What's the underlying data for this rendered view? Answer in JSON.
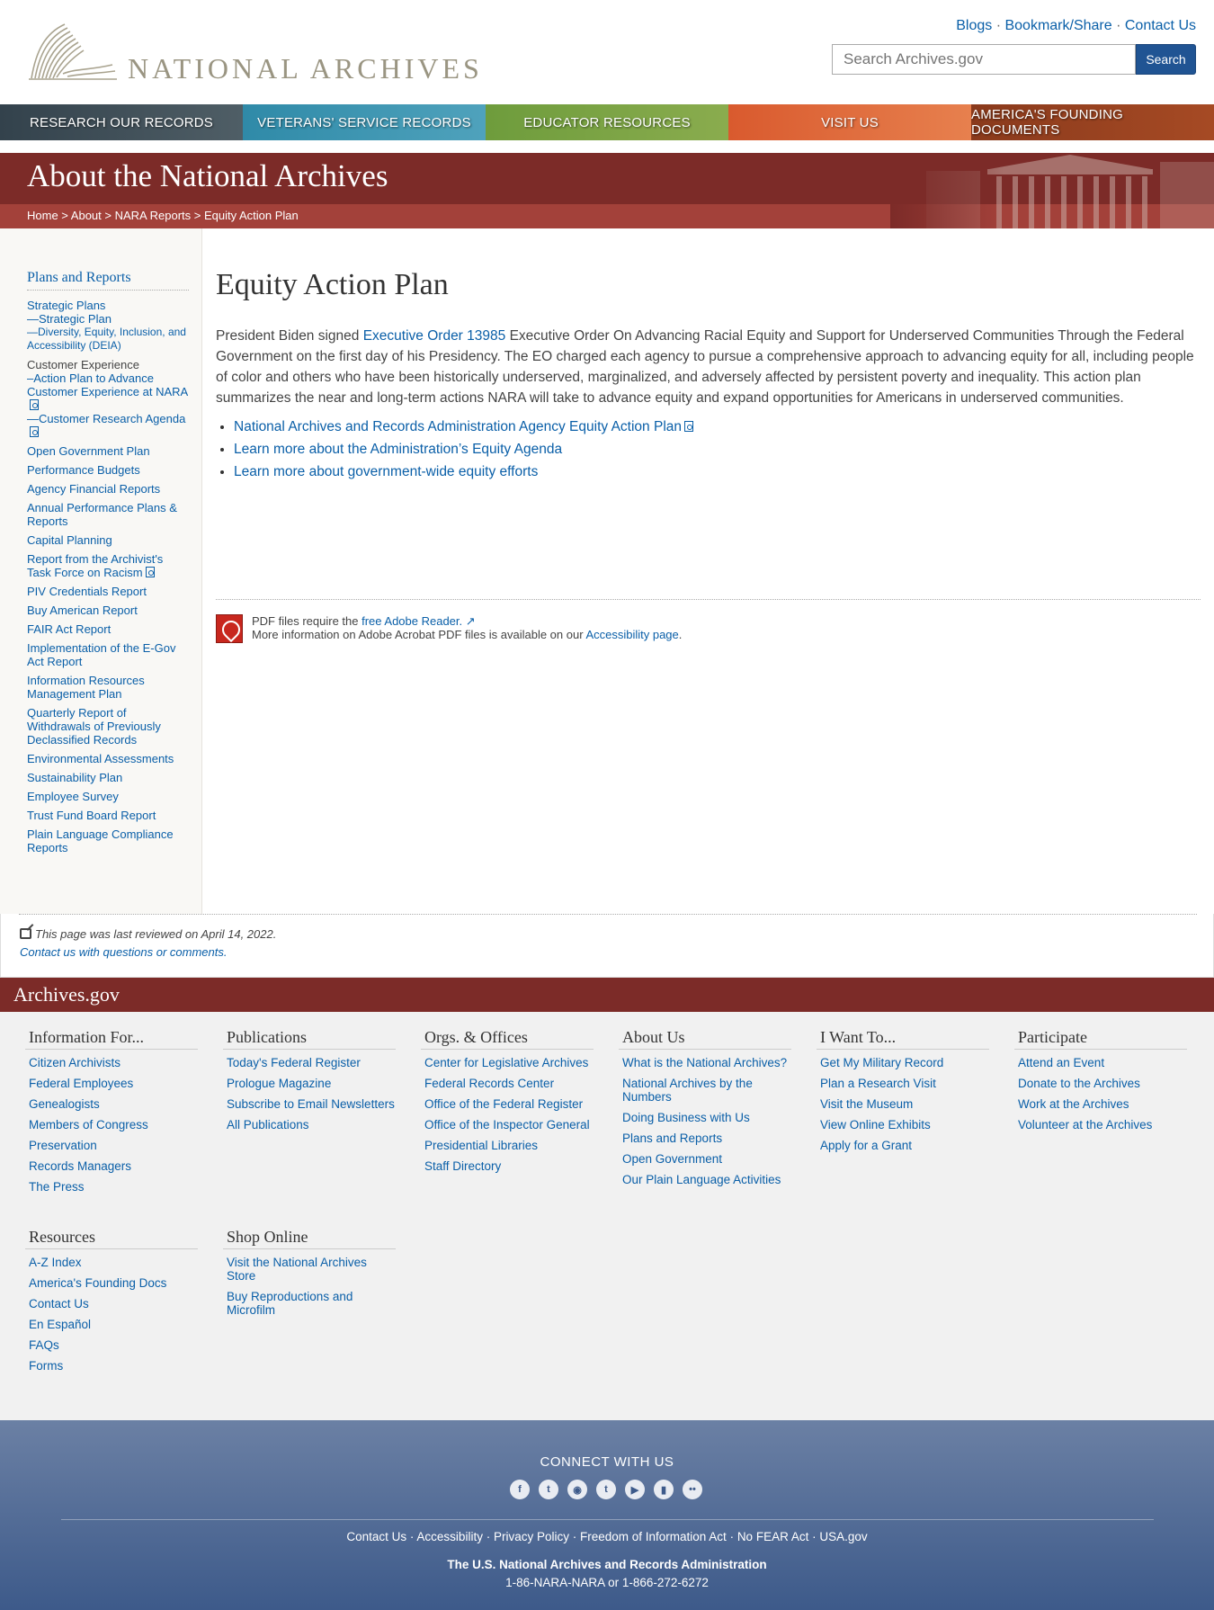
{
  "header": {
    "logo_text": "NATIONAL ARCHIVES",
    "util_links": [
      "Blogs",
      "Bookmark/Share",
      "Contact Us"
    ],
    "search_placeholder": "Search Archives.gov",
    "search_button": "Search"
  },
  "nav": {
    "items": [
      "RESEARCH OUR RECORDS",
      "VETERANS' SERVICE RECORDS",
      "EDUCATOR RESOURCES",
      "VISIT US",
      "AMERICA'S FOUNDING DOCUMENTS"
    ]
  },
  "banner": {
    "title": "About the National Archives",
    "breadcrumb": [
      "Home",
      "About",
      "NARA Reports",
      "Equity Action Plan"
    ]
  },
  "sidebar": {
    "title": "Plans and Reports",
    "strategic_plans": "Strategic Plans",
    "strategic_plan": "—Strategic Plan",
    "deia": "—Diversity, Equity, Inclusion, and Accessibility (DEIA)",
    "customer_experience": "Customer Experience",
    "cx_action_plan": "–Action Plan to Advance Customer Experience at NARA",
    "cx_research_agenda": "—Customer Research Agenda",
    "items": [
      "Open Government Plan",
      "Performance Budgets",
      "Agency Financial Reports",
      "Annual Performance Plans & Reports",
      "Capital Planning",
      "Report from the Archivist's Task Force on Racism",
      "PIV Credentials Report",
      "Buy American Report",
      "FAIR Act Report",
      "Implementation of the E-Gov Act Report",
      "Information Resources Management Plan",
      "Quarterly Report of Withdrawals of Previously Declassified Records",
      "Environmental Assessments",
      "Sustainability Plan",
      "Employee Survey",
      "Trust Fund Board Report",
      "Plain Language Compliance Reports"
    ]
  },
  "main": {
    "title": "Equity Action Plan",
    "intro_before": "President Biden signed ",
    "intro_link": "Executive Order 13985",
    "intro_after": " Executive Order On Advancing Racial Equity and Support for Underserved Communities Through the Federal Government on the first day of his Presidency. The EO charged each agency to pursue a comprehensive approach to advancing equity for all, including people of color and others who have been historically underserved, marginalized, and adversely affected by persistent poverty and inequality. This action plan summarizes the near and long-term actions NARA will take to advance equity and expand opportunities for Americans in underserved communities.",
    "links": [
      "National Archives and Records Administration Agency Equity Action Plan",
      "Learn more about the Administration’s Equity Agenda",
      "Learn more about government-wide equity efforts"
    ],
    "pdf_note_1": "PDF files require the ",
    "pdf_note_link": "free Adobe Reader.",
    "pdf_note_2": "More information on Adobe Acrobat PDF files is available on our ",
    "pdf_note_link2": "Accessibility page",
    "pdf_note_end": "."
  },
  "review": {
    "text": "This page was last reviewed on April 14, 2022.",
    "contact": "Contact us with questions or comments."
  },
  "footer": {
    "bar_title": "Archives.gov",
    "columns": [
      {
        "title": "Information For...",
        "links": [
          "Citizen Archivists",
          "Federal Employees",
          "Genealogists",
          "Members of Congress",
          "Preservation",
          "Records Managers",
          "The Press"
        ]
      },
      {
        "title": "Publications",
        "links": [
          "Today's Federal Register",
          "Prologue Magazine",
          "Subscribe to Email Newsletters",
          "All Publications"
        ]
      },
      {
        "title": "Orgs. & Offices",
        "links": [
          "Center for Legislative Archives",
          "Federal Records Center",
          "Office of the Federal Register",
          "Office of the Inspector General",
          "Presidential Libraries",
          "Staff Directory"
        ]
      },
      {
        "title": "About Us",
        "links": [
          "What is the National Archives?",
          "National Archives by the Numbers",
          "Doing Business with Us",
          "Plans and Reports",
          "Open Government",
          "Our Plain Language Activities"
        ]
      },
      {
        "title": "I Want To...",
        "links": [
          "Get My Military Record",
          "Plan a Research Visit",
          "Visit the Museum",
          "View Online Exhibits",
          "Apply for a Grant"
        ]
      },
      {
        "title": "Participate",
        "links": [
          "Attend an Event",
          "Donate to the Archives",
          "Work at the Archives",
          "Volunteer at the Archives"
        ]
      },
      {
        "title": "Resources",
        "links": [
          "A-Z Index",
          "America's Founding Docs",
          "Contact Us",
          "En Español",
          "FAQs",
          "Forms"
        ]
      },
      {
        "title": "Shop Online",
        "links": [
          "Visit the National Archives Store",
          "Buy Reproductions and Microfilm"
        ]
      }
    ]
  },
  "bottom": {
    "connect": "CONNECT WITH US",
    "socials": [
      "facebook-icon",
      "twitter-icon",
      "instagram-icon",
      "tumblr-icon",
      "youtube-icon",
      "blog-icon",
      "flickr-icon"
    ],
    "links": [
      "Contact Us",
      "Accessibility",
      "Privacy Policy",
      "Freedom of Information Act",
      "No FEAR Act",
      "USA.gov"
    ],
    "agency": "The U.S. National Archives and Records Administration",
    "phone": "1-86-NARA-NARA or 1-866-272-6272"
  }
}
